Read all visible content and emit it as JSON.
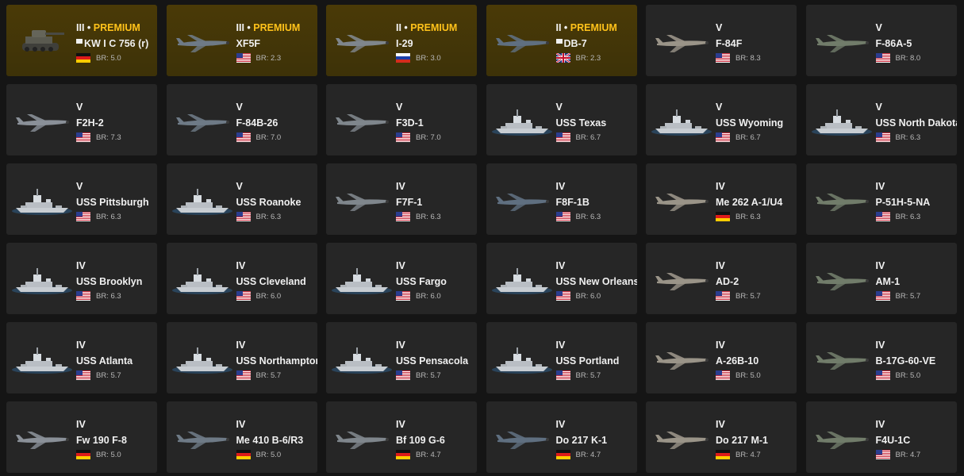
{
  "colors": {
    "premium_text": "#ffc21a",
    "card_bg": "#262626",
    "premium_bg": "#453607",
    "page_bg": "#151515"
  },
  "cards": [
    {
      "rank": "III",
      "premium": "PREMIUM",
      "name": "KW I C 756 (r)",
      "flag": "germany",
      "br": "BR: 5.0",
      "kind": "tank"
    },
    {
      "rank": "III",
      "premium": "PREMIUM",
      "name": "XF5F",
      "flag": "usa",
      "br": "BR: 2.3",
      "kind": "plane"
    },
    {
      "rank": "II",
      "premium": "PREMIUM",
      "name": "I-29",
      "flag": "russia",
      "br": "BR: 3.0",
      "kind": "plane"
    },
    {
      "rank": "II",
      "premium": "PREMIUM",
      "name": "DB-7",
      "flag": "uk",
      "br": "BR: 2.3",
      "kind": "plane"
    },
    {
      "rank": "V",
      "premium": "",
      "name": "F-84F",
      "flag": "usa",
      "br": "BR: 8.3",
      "kind": "plane"
    },
    {
      "rank": "V",
      "premium": "",
      "name": "F-86A-5",
      "flag": "usa",
      "br": "BR: 8.0",
      "kind": "plane"
    },
    {
      "rank": "V",
      "premium": "",
      "name": "F2H-2",
      "flag": "usa",
      "br": "BR: 7.3",
      "kind": "plane"
    },
    {
      "rank": "V",
      "premium": "",
      "name": "F-84B-26",
      "flag": "usa",
      "br": "BR: 7.0",
      "kind": "plane"
    },
    {
      "rank": "V",
      "premium": "",
      "name": "F3D-1",
      "flag": "usa",
      "br": "BR: 7.0",
      "kind": "plane"
    },
    {
      "rank": "V",
      "premium": "",
      "name": "USS Texas",
      "flag": "usa",
      "br": "BR: 6.7",
      "kind": "ship"
    },
    {
      "rank": "V",
      "premium": "",
      "name": "USS Wyoming",
      "flag": "usa",
      "br": "BR: 6.7",
      "kind": "ship"
    },
    {
      "rank": "V",
      "premium": "",
      "name": "USS North Dakota",
      "flag": "usa",
      "br": "BR: 6.3",
      "kind": "ship"
    },
    {
      "rank": "V",
      "premium": "",
      "name": "USS Pittsburgh",
      "flag": "usa",
      "br": "BR: 6.3",
      "kind": "ship"
    },
    {
      "rank": "V",
      "premium": "",
      "name": "USS Roanoke",
      "flag": "usa",
      "br": "BR: 6.3",
      "kind": "ship"
    },
    {
      "rank": "IV",
      "premium": "",
      "name": "F7F-1",
      "flag": "usa",
      "br": "BR: 6.3",
      "kind": "plane"
    },
    {
      "rank": "IV",
      "premium": "",
      "name": "F8F-1B",
      "flag": "usa",
      "br": "BR: 6.3",
      "kind": "plane"
    },
    {
      "rank": "IV",
      "premium": "",
      "name": "Me 262 A-1/U4",
      "flag": "germany",
      "br": "BR: 6.3",
      "kind": "plane"
    },
    {
      "rank": "IV",
      "premium": "",
      "name": "P-51H-5-NA",
      "flag": "usa",
      "br": "BR: 6.3",
      "kind": "plane"
    },
    {
      "rank": "IV",
      "premium": "",
      "name": "USS Brooklyn",
      "flag": "usa",
      "br": "BR: 6.3",
      "kind": "ship"
    },
    {
      "rank": "IV",
      "premium": "",
      "name": "USS Cleveland",
      "flag": "usa",
      "br": "BR: 6.0",
      "kind": "ship"
    },
    {
      "rank": "IV",
      "premium": "",
      "name": "USS Fargo",
      "flag": "usa",
      "br": "BR: 6.0",
      "kind": "ship"
    },
    {
      "rank": "IV",
      "premium": "",
      "name": "USS New Orleans",
      "flag": "usa",
      "br": "BR: 6.0",
      "kind": "ship"
    },
    {
      "rank": "IV",
      "premium": "",
      "name": "AD-2",
      "flag": "usa",
      "br": "BR: 5.7",
      "kind": "plane"
    },
    {
      "rank": "IV",
      "premium": "",
      "name": "AM-1",
      "flag": "usa",
      "br": "BR: 5.7",
      "kind": "plane"
    },
    {
      "rank": "IV",
      "premium": "",
      "name": "USS Atlanta",
      "flag": "usa",
      "br": "BR: 5.7",
      "kind": "ship"
    },
    {
      "rank": "IV",
      "premium": "",
      "name": "USS Northampton",
      "flag": "usa",
      "br": "BR: 5.7",
      "kind": "ship"
    },
    {
      "rank": "IV",
      "premium": "",
      "name": "USS Pensacola",
      "flag": "usa",
      "br": "BR: 5.7",
      "kind": "ship"
    },
    {
      "rank": "IV",
      "premium": "",
      "name": "USS Portland",
      "flag": "usa",
      "br": "BR: 5.7",
      "kind": "ship"
    },
    {
      "rank": "IV",
      "premium": "",
      "name": "A-26B-10",
      "flag": "usa",
      "br": "BR: 5.0",
      "kind": "plane"
    },
    {
      "rank": "IV",
      "premium": "",
      "name": "B-17G-60-VE",
      "flag": "usa",
      "br": "BR: 5.0",
      "kind": "plane"
    },
    {
      "rank": "IV",
      "premium": "",
      "name": "Fw 190 F-8",
      "flag": "germany",
      "br": "BR: 5.0",
      "kind": "plane"
    },
    {
      "rank": "IV",
      "premium": "",
      "name": "Me 410 B-6/R3",
      "flag": "germany",
      "br": "BR: 5.0",
      "kind": "plane"
    },
    {
      "rank": "IV",
      "premium": "",
      "name": "Bf 109 G-6",
      "flag": "germany",
      "br": "BR: 4.7",
      "kind": "plane"
    },
    {
      "rank": "IV",
      "premium": "",
      "name": "Do 217 K-1",
      "flag": "germany",
      "br": "BR: 4.7",
      "kind": "plane"
    },
    {
      "rank": "IV",
      "premium": "",
      "name": "Do 217 M-1",
      "flag": "germany",
      "br": "BR: 4.7",
      "kind": "plane"
    },
    {
      "rank": "IV",
      "premium": "",
      "name": "F4U-1C",
      "flag": "usa",
      "br": "BR: 4.7",
      "kind": "plane"
    }
  ]
}
